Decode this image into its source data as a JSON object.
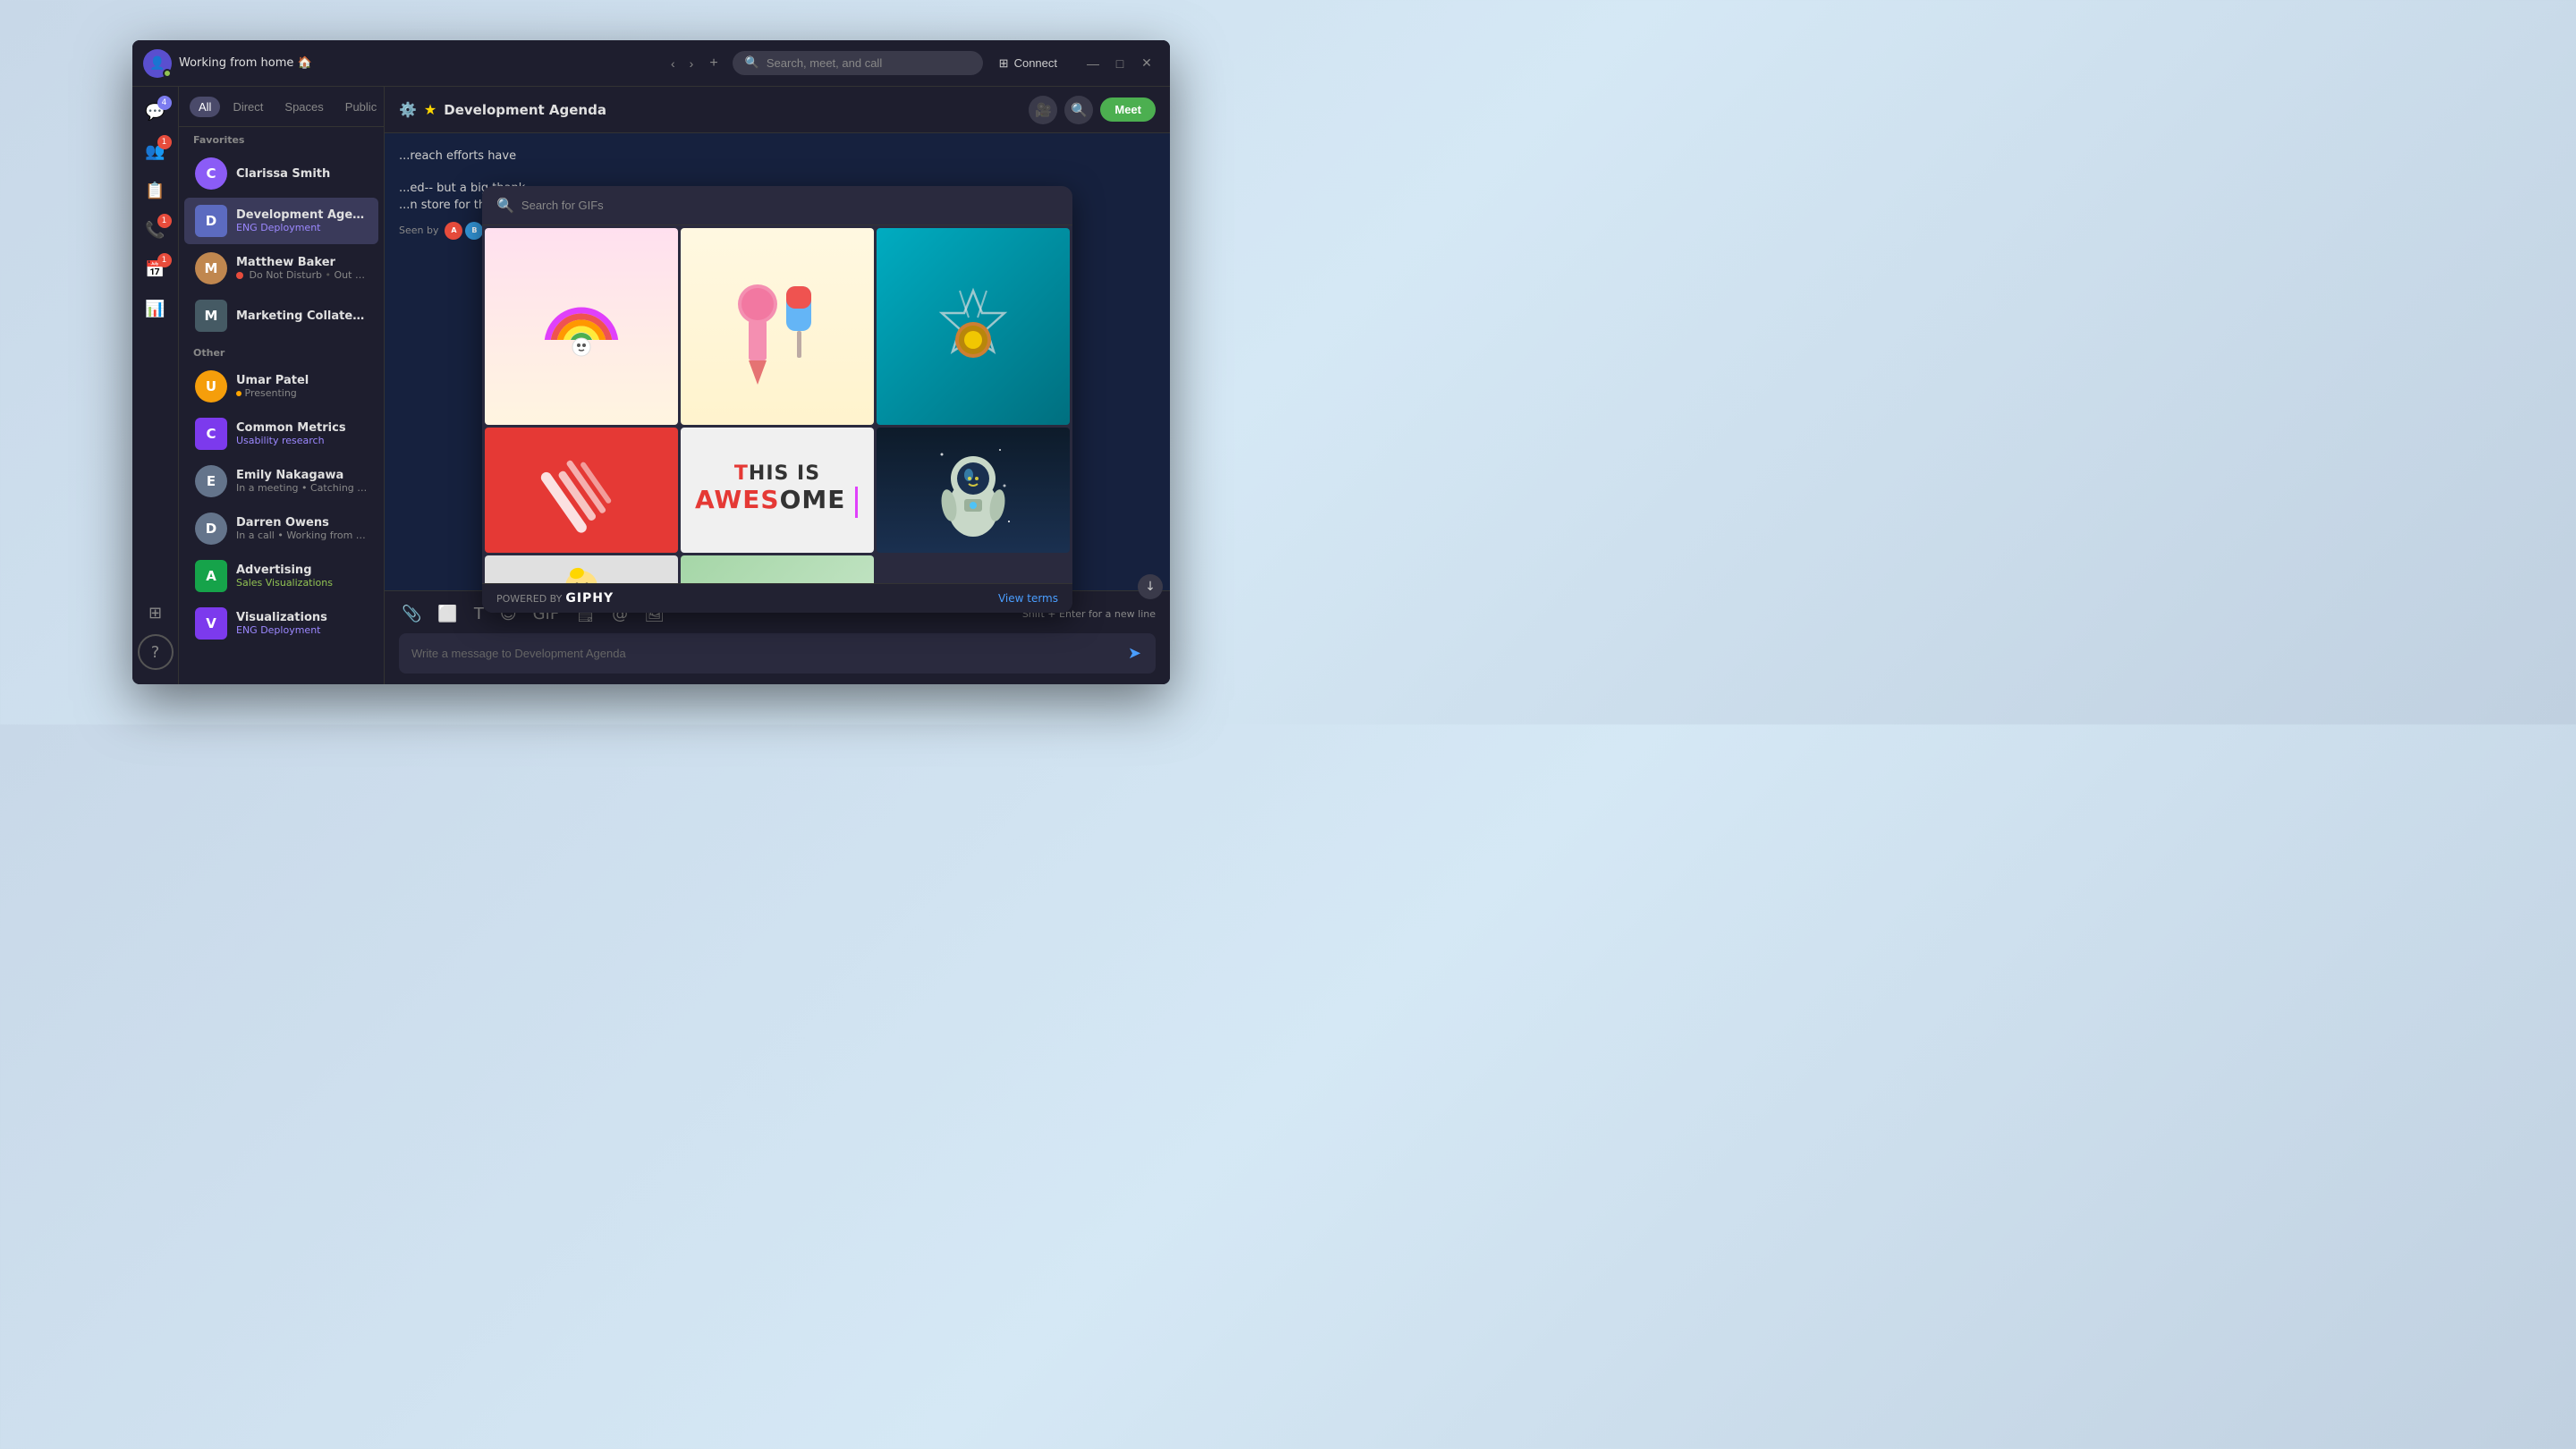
{
  "window": {
    "title": "Working from home 🏠",
    "search_placeholder": "Search, meet, and call",
    "connect_label": "Connect",
    "minimize": "—",
    "maximize": "□",
    "close": "✕"
  },
  "icon_sidebar": {
    "items": [
      {
        "name": "chat",
        "icon": "💬",
        "badge": "4",
        "badge_color": "purple"
      },
      {
        "name": "team",
        "icon": "👥",
        "badge": "1",
        "badge_color": "red"
      },
      {
        "name": "contacts",
        "icon": "📋",
        "badge": null
      },
      {
        "name": "calls",
        "icon": "📞",
        "badge": "1",
        "badge_color": "red"
      },
      {
        "name": "calendar",
        "icon": "📅",
        "badge": "1",
        "badge_color": "red"
      },
      {
        "name": "analytics",
        "icon": "📊",
        "badge": null
      }
    ],
    "help": "?"
  },
  "channel_list": {
    "tabs": [
      {
        "label": "All",
        "active": true
      },
      {
        "label": "Direct",
        "active": false
      },
      {
        "label": "Spaces",
        "active": false
      },
      {
        "label": "Public",
        "active": false
      }
    ],
    "filter_icon": "☰",
    "sections": {
      "favorites_label": "Favorites",
      "other_label": "Other"
    },
    "favorites": [
      {
        "name": "Clarissa Smith",
        "avatar_color": "#8b5cf6",
        "avatar_letter": "CS",
        "sub": "",
        "sub_color": "",
        "active": false
      },
      {
        "name": "Development Agenda",
        "avatar_color": "#5c6bc0",
        "avatar_letter": "D",
        "sub": "ENG Deployment",
        "sub_color": "purple",
        "active": true
      },
      {
        "name": "Matthew Baker",
        "avatar_color": "#c0874f",
        "avatar_letter": "MB",
        "sub": "Do Not Disturb  •  Out for a wa...",
        "sub_color": "red",
        "active": false
      },
      {
        "name": "Marketing Collateral",
        "avatar_color": "#455a64",
        "avatar_letter": "M",
        "sub": "",
        "sub_color": "",
        "active": false
      }
    ],
    "others": [
      {
        "name": "Umar Patel",
        "avatar_color": "#f59e0b",
        "avatar_letter": "UP",
        "sub": "Presenting",
        "sub_color": "orange",
        "active": false
      },
      {
        "name": "Common Metrics",
        "avatar_color": "#7c3aed",
        "avatar_letter": "C",
        "sub": "Usability research",
        "sub_color": "purple",
        "active": false
      },
      {
        "name": "Emily Nakagawa",
        "avatar_color": "#64748b",
        "avatar_letter": "EN",
        "sub": "In a meeting  •  Catching up",
        "sub_color": "",
        "active": false
      },
      {
        "name": "Darren Owens",
        "avatar_color": "#64748b",
        "avatar_letter": "DO",
        "sub": "In a call  •  Working from home",
        "sub_color": "",
        "active": false
      },
      {
        "name": "Advertising",
        "avatar_color": "#16a34a",
        "avatar_letter": "A",
        "sub": "Sales Visualizations",
        "sub_color": "green",
        "active": false
      },
      {
        "name": "Visualizations",
        "avatar_color": "#7c3aed",
        "avatar_letter": "V",
        "sub": "ENG Deployment",
        "sub_color": "purple",
        "active": false
      }
    ]
  },
  "chat": {
    "header": {
      "title": "Development Agenda",
      "meet_label": "Meet",
      "starred": true
    },
    "messages": [
      {
        "text": "...reach efforts have",
        "partial": true
      },
      {
        "text": "...ed-- but a big thank\n...n store for this year!",
        "partial": true
      }
    ],
    "seen_label": "Seen by",
    "input_placeholder": "Write a message to Development Agenda",
    "shift_enter_hint": "Shift + Enter for a new line"
  },
  "gif_picker": {
    "search_placeholder": "Search for GIFs",
    "footer": {
      "powered_by": "POWERED BY",
      "brand": "GIPHY",
      "view_terms_label": "View terms"
    }
  }
}
